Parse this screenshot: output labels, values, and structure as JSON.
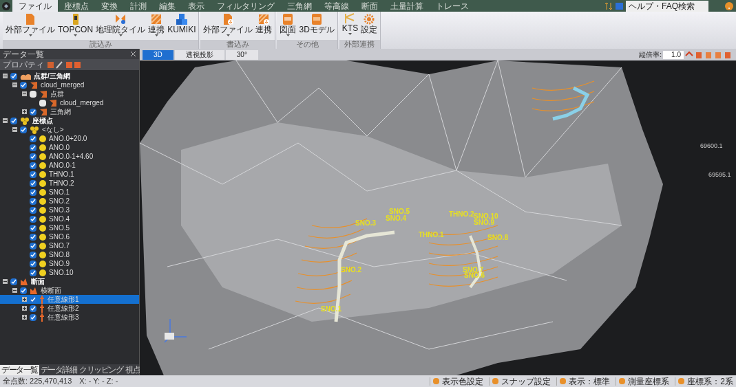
{
  "menu_tabs": [
    {
      "label": "ファイル",
      "selected": true
    },
    {
      "label": "座標点",
      "selected": false
    },
    {
      "label": "変換",
      "selected": false
    },
    {
      "label": "計測",
      "selected": false
    },
    {
      "label": "編集",
      "selected": false
    },
    {
      "label": "表示",
      "selected": false
    },
    {
      "label": "フィルタリング",
      "selected": false
    },
    {
      "label": "三角網",
      "selected": false
    },
    {
      "label": "等高線",
      "selected": false
    },
    {
      "label": "断面",
      "selected": false
    },
    {
      "label": "土量計算",
      "selected": false
    },
    {
      "label": "トレース",
      "selected": false
    }
  ],
  "help_search": {
    "value": "ヘルプ・FAQ検索"
  },
  "ribbon_groups": [
    {
      "label": "読込み",
      "buttons": [
        {
          "label": "外部ファイル",
          "kind": "file",
          "dropdown": true
        },
        {
          "label": "TOPCON",
          "kind": "device",
          "dropdown": true
        },
        {
          "label": "地理院タイル",
          "kind": "tile",
          "dropdown": true
        },
        {
          "label": "連携",
          "kind": "link",
          "dropdown": true
        },
        {
          "label": "KUMIKI",
          "kind": "blocks",
          "dropdown": false
        }
      ]
    },
    {
      "label": "書込み",
      "buttons": [
        {
          "label": "外部ファイル",
          "kind": "file_out",
          "dropdown": true
        },
        {
          "label": "連携",
          "kind": "link_out",
          "dropdown": false
        }
      ]
    },
    {
      "label": "その他",
      "buttons": [
        {
          "label": "図面",
          "kind": "cad",
          "dropdown": true
        },
        {
          "label": "3Dモデル",
          "kind": "model3d",
          "dropdown": false
        }
      ]
    },
    {
      "label": "外部連携",
      "buttons": [
        {
          "label": "KTS",
          "kind": "kts",
          "dropdown": true
        },
        {
          "label": "設定",
          "kind": "gear",
          "dropdown": false
        }
      ]
    }
  ],
  "data_panel": {
    "title": "データ一覧",
    "property_button": "プロパティ",
    "tree": [
      {
        "label": "点群/三角網",
        "kind": "cloud",
        "checked": true,
        "expanded": true,
        "selected": false,
        "children": [
          {
            "label": "cloud_merged",
            "kind": "layer",
            "checked": true,
            "expanded": true,
            "selected": false,
            "children": [
              {
                "label": "点群",
                "kind": "layer",
                "checked": false,
                "expanded": true,
                "selected": false,
                "children": [
                  {
                    "label": "cloud_merged",
                    "kind": "layer",
                    "checked": false,
                    "selected": false
                  }
                ]
              },
              {
                "label": "三角網",
                "kind": "layer",
                "checked": true,
                "expanded": false,
                "selected": false
              }
            ]
          }
        ]
      },
      {
        "label": "座標点",
        "kind": "points",
        "checked": true,
        "expanded": true,
        "selected": false,
        "children": [
          {
            "label": "<なし>",
            "kind": "points",
            "checked": true,
            "expanded": true,
            "selected": false,
            "children": [
              {
                "label": "ANO.0+20.0",
                "kind": "point",
                "checked": true,
                "selected": false
              },
              {
                "label": "ANO.0",
                "kind": "point",
                "checked": true,
                "selected": false
              },
              {
                "label": "ANO.0-1+4.60",
                "kind": "point",
                "checked": true,
                "selected": false
              },
              {
                "label": "ANO.0-1",
                "kind": "point",
                "checked": true,
                "selected": false
              },
              {
                "label": "THNO.1",
                "kind": "point",
                "checked": true,
                "selected": false
              },
              {
                "label": "THNO.2",
                "kind": "point",
                "checked": true,
                "selected": false
              },
              {
                "label": "SNO.1",
                "kind": "point",
                "checked": true,
                "selected": false
              },
              {
                "label": "SNO.2",
                "kind": "point",
                "checked": true,
                "selected": false
              },
              {
                "label": "SNO.3",
                "kind": "point",
                "checked": true,
                "selected": false
              },
              {
                "label": "SNO.4",
                "kind": "point",
                "checked": true,
                "selected": false
              },
              {
                "label": "SNO.5",
                "kind": "point",
                "checked": true,
                "selected": false
              },
              {
                "label": "SNO.6",
                "kind": "point",
                "checked": true,
                "selected": false
              },
              {
                "label": "SNO.7",
                "kind": "point",
                "checked": true,
                "selected": false
              },
              {
                "label": "SNO.8",
                "kind": "point",
                "checked": true,
                "selected": false
              },
              {
                "label": "SNO.9",
                "kind": "point",
                "checked": true,
                "selected": false
              },
              {
                "label": "SNO.10",
                "kind": "point",
                "checked": true,
                "selected": false
              }
            ]
          }
        ]
      },
      {
        "label": "断面",
        "kind": "section",
        "checked": true,
        "expanded": true,
        "selected": false,
        "children": [
          {
            "label": "横断面",
            "kind": "section",
            "checked": true,
            "expanded": true,
            "selected": false,
            "children": [
              {
                "label": "任意線形1",
                "kind": "line",
                "checked": true,
                "expanded": false,
                "selected": true
              },
              {
                "label": "任意線形2",
                "kind": "line",
                "checked": true,
                "expanded": false,
                "selected": false
              },
              {
                "label": "任意線形3",
                "kind": "line",
                "checked": true,
                "expanded": false,
                "selected": false
              }
            ]
          }
        ]
      }
    ],
    "bottom_tabs": [
      {
        "label": "データ一覧",
        "selected": true
      },
      {
        "label": "データ詳細",
        "selected": false
      },
      {
        "label": "クリッピング",
        "selected": false
      },
      {
        "label": "視点",
        "selected": false
      }
    ]
  },
  "view_tabs": [
    {
      "label": "3D",
      "selected": true
    },
    {
      "label": "透視投影",
      "selected": false
    },
    {
      "label": "30°",
      "selected": false
    }
  ],
  "vertical_scale": {
    "label": "縦倍率:",
    "value": "1.0"
  },
  "scene_labels": [
    "SNO.5",
    "SNO.4",
    "SNO.3",
    "THNO.2",
    "SNO.10",
    "SNO.9",
    "THNO.1",
    "SNO.8",
    "SNO.2",
    "SNO.7",
    "SNO.6",
    "SNO.1"
  ],
  "grid_coordinates": [
    "69600.1",
    "69595.1"
  ],
  "status_left": "全点数: 225,470,413　X: - Y: - Z: -",
  "status_items": [
    "表示色設定",
    "スナップ設定",
    "表示：標準",
    "測量座標系",
    "座標系：2系"
  ]
}
